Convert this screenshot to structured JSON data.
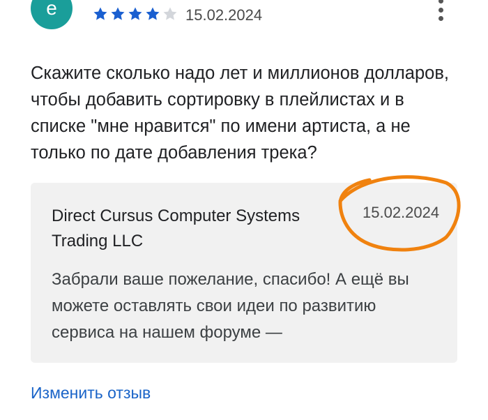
{
  "review": {
    "avatar_letter": "е",
    "rating": 4,
    "max_rating": 5,
    "star_filled_color": "#1a5fd0",
    "star_empty_color": "#d3d6db",
    "date": "15.02.2024",
    "text": "Скажите сколько надо лет и миллионов долларов, чтобы добавить сортировку в плейлистах и в списке \"мне нравится\" по имени артиста, а не только по дате добавления трека?"
  },
  "reply": {
    "developer": "Direct Cursus Computer Systems Trading LLC",
    "date": "15.02.2024",
    "text": "Забрали ваше пожелание, спасибо! А ещё вы можете оставлять свои идеи по развитию сервиса на нашем форуме —"
  },
  "actions": {
    "edit_review": "Изменить отзыв"
  },
  "annotation": {
    "color": "#f0820f"
  }
}
